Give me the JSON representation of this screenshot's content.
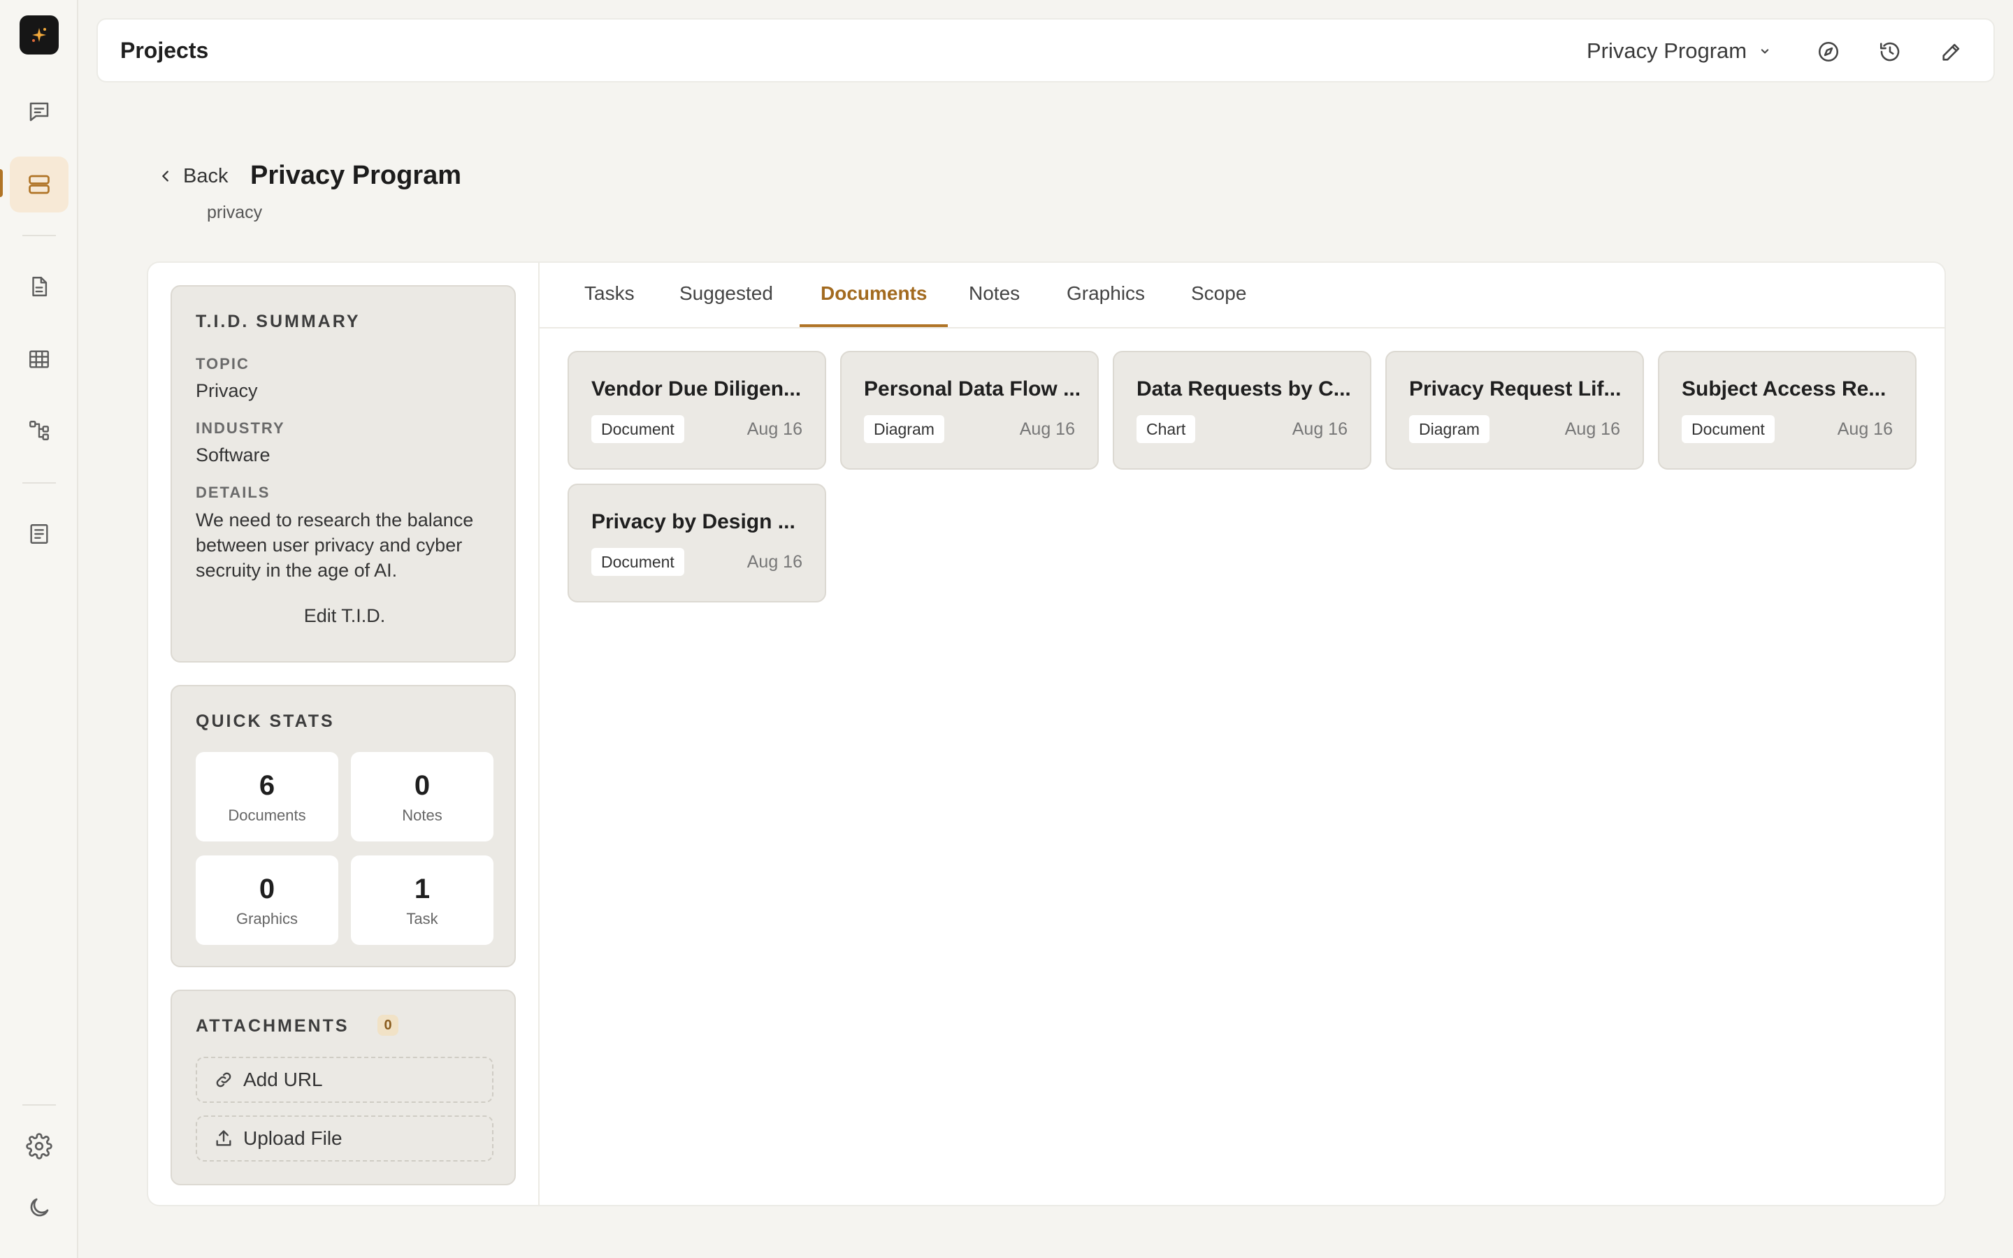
{
  "app": {
    "title": "Projects"
  },
  "project_selector": {
    "value": "Privacy Program"
  },
  "header": {
    "back_label": "Back",
    "title": "Privacy Program",
    "subtitle": "privacy"
  },
  "tid_summary": {
    "heading": "T.I.D. SUMMARY",
    "topic_label": "TOPIC",
    "topic_value": "Privacy",
    "industry_label": "INDUSTRY",
    "industry_value": "Software",
    "details_label": "DETAILS",
    "details_value": "We need to research the balance between user privacy and cyber secruity in the age of AI.",
    "edit_label": "Edit T.I.D."
  },
  "quick_stats": {
    "heading": "QUICK STATS",
    "items": [
      {
        "value": "6",
        "label": "Documents"
      },
      {
        "value": "0",
        "label": "Notes"
      },
      {
        "value": "0",
        "label": "Graphics"
      },
      {
        "value": "1",
        "label": "Task"
      }
    ]
  },
  "attachments": {
    "heading": "ATTACHMENTS",
    "count": "0",
    "add_url_label": "Add URL",
    "upload_label": "Upload File"
  },
  "tabs": [
    {
      "label": "Tasks"
    },
    {
      "label": "Suggested"
    },
    {
      "label": "Documents",
      "active": true
    },
    {
      "label": "Notes"
    },
    {
      "label": "Graphics"
    },
    {
      "label": "Scope"
    }
  ],
  "documents": [
    {
      "title": "Vendor Due Diligen...",
      "type": "Document",
      "date": "Aug 16"
    },
    {
      "title": "Personal Data Flow ...",
      "type": "Diagram",
      "date": "Aug 16"
    },
    {
      "title": "Data Requests by C...",
      "type": "Chart",
      "date": "Aug 16"
    },
    {
      "title": "Privacy Request Lif...",
      "type": "Diagram",
      "date": "Aug 16"
    },
    {
      "title": "Subject Access Re...",
      "type": "Document",
      "date": "Aug 16"
    },
    {
      "title": "Privacy by Design ...",
      "type": "Document",
      "date": "Aug 16"
    }
  ],
  "colors": {
    "accent": "#b07426",
    "accent_bg": "#f7e9d6",
    "page_bg": "#f5f4f0",
    "card_bg": "#ebe9e4"
  },
  "icons": {
    "logo": "sparkle-icon",
    "rail": [
      "chat-icon",
      "projects-icon",
      "document-icon",
      "table-icon",
      "flow-icon",
      "notes-icon",
      "gear-icon",
      "moon-icon"
    ],
    "topbar": [
      "compass-icon",
      "history-icon",
      "edit-icon"
    ]
  }
}
